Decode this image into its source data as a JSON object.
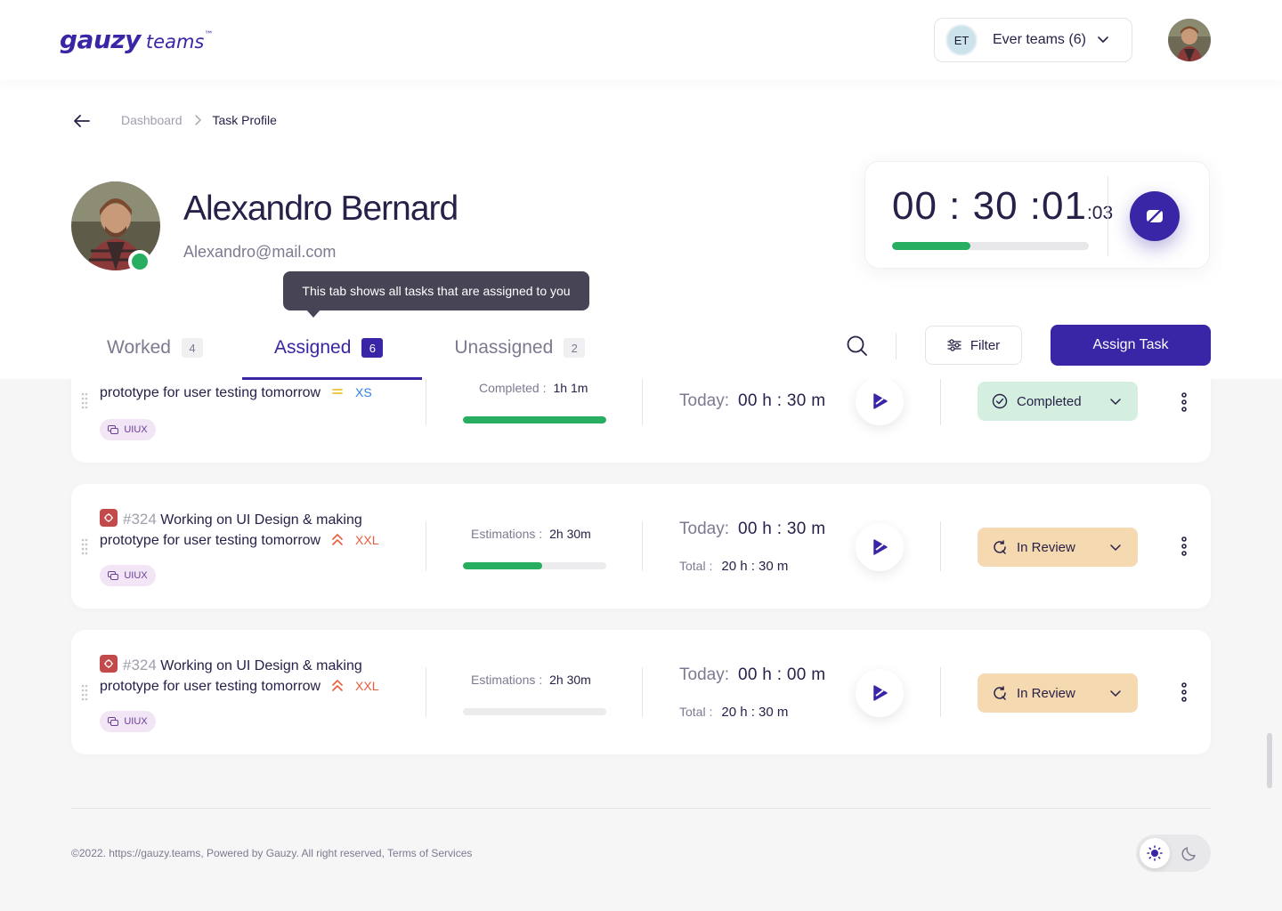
{
  "brand": {
    "name": "gauzy",
    "product": "teams",
    "tm": "™"
  },
  "team_selector": {
    "initials": "ET",
    "label": "Ever teams (6)"
  },
  "breadcrumb": {
    "items": [
      "Dashboard"
    ],
    "current": "Task Profile"
  },
  "profile": {
    "name": "Alexandro Bernard",
    "email": "Alexandro@mail.com"
  },
  "timer": {
    "time": "00 : 30 :01",
    "ms": ":03",
    "progress": 0.4
  },
  "tooltip": "This tab shows all tasks that are assigned to you",
  "tabs": [
    {
      "label": "Worked",
      "count": "4",
      "active": false
    },
    {
      "label": "Assigned",
      "count": "6",
      "active": true
    },
    {
      "label": "Unassigned",
      "count": "2",
      "active": false
    }
  ],
  "toolbar": {
    "filter_label": "Filter",
    "assign_label": "Assign Task"
  },
  "tasks": [
    {
      "id": "",
      "title_line1": "",
      "title_line2": "prototype for user testing tomorrow",
      "priority": "medium",
      "size": "XS",
      "tag": "UIUX",
      "est_label": "Completed :",
      "est_value": "1h 1m",
      "progress": 1.0,
      "today_label": "Today:",
      "today_value": "00 h : 30 m",
      "total_label": "",
      "total_value": "",
      "status": "Completed"
    },
    {
      "id": "#324",
      "title_line1": "Working on UI Design & making",
      "title_line2": "prototype for user testing tomorrow",
      "priority": "high",
      "size": "XXL",
      "tag": "UIUX",
      "est_label": "Estimations :",
      "est_value": "2h 30m",
      "progress": 0.55,
      "today_label": "Today:",
      "today_value": "00 h : 30 m",
      "total_label": "Total :",
      "total_value": "20 h : 30 m",
      "status": "In Review"
    },
    {
      "id": "#324",
      "title_line1": "Working on UI Design & making",
      "title_line2": "prototype for user testing tomorrow",
      "priority": "high",
      "size": "XXL",
      "tag": "UIUX",
      "est_label": "Estimations :",
      "est_value": "2h 30m",
      "progress": 0.0,
      "today_label": "Today:",
      "today_value": "00 h : 00 m",
      "total_label": "Total :",
      "total_value": "20 h : 30 m",
      "status": "In Review"
    }
  ],
  "footer": {
    "text": "©2022. https://gauzy.teams, Powered by Gauzy. All right reserved, Terms of Services"
  },
  "colors": {
    "brand": "#3826A6",
    "success": "#27AE60",
    "review": "#F5D9B0",
    "completed": "#D4EFDF",
    "xxl": "#E85C3C",
    "xs": "#2F80ED"
  }
}
